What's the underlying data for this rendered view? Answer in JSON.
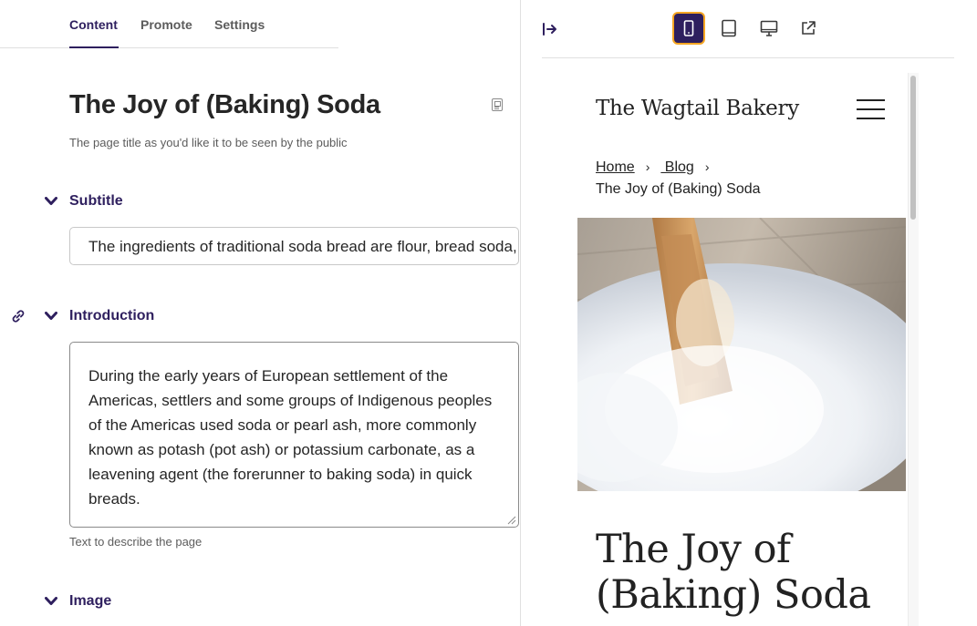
{
  "editor": {
    "tabs": [
      {
        "label": "Content",
        "active": true
      },
      {
        "label": "Promote",
        "active": false
      },
      {
        "label": "Settings",
        "active": false
      }
    ],
    "title": "The Joy of (Baking) Soda",
    "title_help": "The page title as you'd like it to be seen by the public",
    "subtitle": {
      "label": "Subtitle",
      "value": "The ingredients of traditional soda bread are flour, bread soda, salt, and buttermilk."
    },
    "introduction": {
      "label": "Introduction",
      "value": "During the early years of European settlement of the Americas, settlers and some groups of Indigenous peoples of the Americas used soda or pearl ash, more commonly known as potash (pot ash) or potassium carbonate, as a leavening agent (the forerunner to baking soda) in quick breads.",
      "help": "Text to describe the page"
    },
    "image": {
      "label": "Image"
    }
  },
  "preview": {
    "devices": [
      "mobile",
      "tablet",
      "desktop",
      "external-link"
    ],
    "selected_device": "mobile",
    "site_name": "The Wagtail Bakery",
    "breadcrumbs": {
      "home": "Home",
      "blog": " Blog",
      "current": "The Joy of (Baking) Soda"
    },
    "post_title": "The Joy of (Baking) Soda"
  },
  "colors": {
    "accent": "#2e1f5e",
    "focus_ring": "#f5a623",
    "border": "#c8c8c8"
  }
}
